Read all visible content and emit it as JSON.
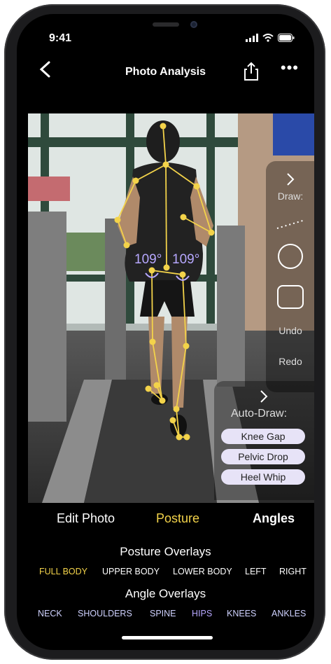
{
  "status_bar": {
    "time": "9:41"
  },
  "nav": {
    "title": "Photo Analysis"
  },
  "draw_panel": {
    "label": "Draw:",
    "undo": "Undo",
    "redo": "Redo"
  },
  "auto_draw": {
    "label": "Auto-Draw:",
    "chips": [
      "Knee Gap",
      "Pelvic Drop",
      "Heel Whip"
    ]
  },
  "angles": {
    "left": "109°",
    "right": "109°"
  },
  "tabs": {
    "edit_photo": "Edit Photo",
    "posture": "Posture",
    "angles": "Angles"
  },
  "posture_overlays": {
    "title": "Posture Overlays",
    "items": [
      "FULL BODY",
      "UPPER BODY",
      "LOWER BODY",
      "LEFT",
      "RIGHT"
    ],
    "active": "FULL BODY"
  },
  "angle_overlays": {
    "title": "Angle Overlays",
    "items": [
      "NECK",
      "SHOULDERS",
      "SPINE",
      "HIPS",
      "KNEES",
      "ANKLES"
    ],
    "active": "HIPS"
  },
  "colors": {
    "accent_yellow": "#f3d34a",
    "overlay_purple": "#b7a8ff",
    "background": "#000000",
    "chip": "#e7e3f7"
  }
}
